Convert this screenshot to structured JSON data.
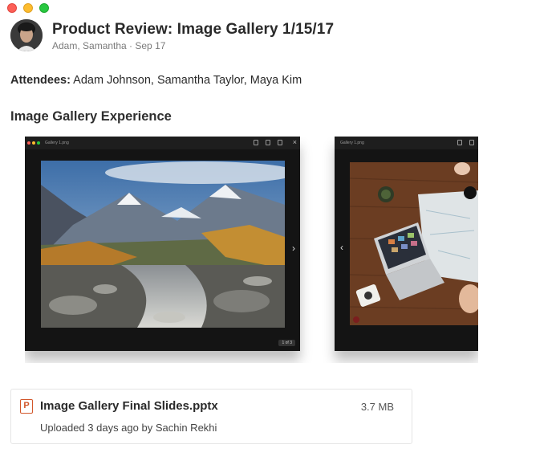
{
  "window": {
    "controls": [
      "close",
      "minimize",
      "zoom"
    ]
  },
  "header": {
    "title": "Product Review: Image Gallery 1/15/17",
    "meta": "Adam, Samantha · Sep 17",
    "avatar": "avatar-icon"
  },
  "attendees": {
    "label": "Attendees:",
    "names": " Adam Johnson, Samantha Taylor, Maya Kim"
  },
  "section": {
    "heading": "Image Gallery Experience"
  },
  "gallery": {
    "shots": [
      {
        "window_title": "Gallery 1.png",
        "image": "mountain-landscape-photo",
        "counter": "1 of 3",
        "nav": "chevron-right-icon"
      },
      {
        "window_title": "Gallery 1.png",
        "image": "desk-laptop-map-photo",
        "nav": "chevron-left-icon"
      }
    ]
  },
  "attachment": {
    "icon": "powerpoint-icon",
    "icon_letter": "P",
    "name": "Image Gallery Final Slides.pptx",
    "size": "3.7 MB",
    "uploaded": "Uploaded 3 days ago by Sachin Rekhi",
    "accent": "#d2572b"
  }
}
